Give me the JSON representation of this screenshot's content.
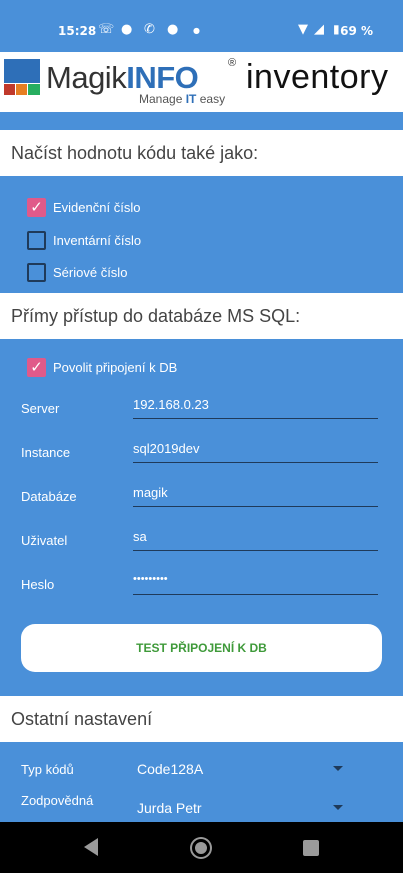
{
  "status_bar": {
    "time": "15:28",
    "icons": [
      "missed-call-icon",
      "chat-bubble-icon",
      "viber-icon",
      "messenger-icon",
      "dot-icon"
    ],
    "right_icons": [
      "wifi-icon",
      "signal-icon",
      "battery-icon"
    ],
    "battery": "69 %"
  },
  "logo": {
    "magik": "Magik",
    "info": "INFO",
    "reg": "®",
    "tagline_prefix": "Manage",
    "tagline_it": "IT",
    "tagline_suffix": "easy",
    "product": "inventory"
  },
  "section_code": {
    "title": "Načíst hodnotu kódu také jako:",
    "options": [
      {
        "label": "Evidenční číslo",
        "checked": true
      },
      {
        "label": "Inventární číslo",
        "checked": false
      },
      {
        "label": "Sériové číslo",
        "checked": false
      }
    ]
  },
  "section_db": {
    "title": "Přímy přístup do databáze MS SQL:",
    "enable": {
      "label": "Povolit připojení k DB",
      "checked": true
    },
    "fields": [
      {
        "label": "Server",
        "value": "192.168.0.23"
      },
      {
        "label": "Instance",
        "value": "sql2019dev"
      },
      {
        "label": "Databáze",
        "value": "magik"
      },
      {
        "label": "Uživatel",
        "value": "sa"
      },
      {
        "label": "Heslo",
        "value": "•••••••••"
      }
    ],
    "test_button": "TEST PŘIPOJENÍ K DB"
  },
  "section_other": {
    "title": "Ostatní nastavení",
    "dropdowns": [
      {
        "label": "Typ kódů",
        "value": "Code128A"
      },
      {
        "label": "Zodpovědná",
        "value": "Jurda Petr"
      }
    ]
  },
  "colors": {
    "background": "#4a90d9",
    "checkbox_checked": "#e05a8a",
    "test_button_text": "#3f9a3a"
  }
}
